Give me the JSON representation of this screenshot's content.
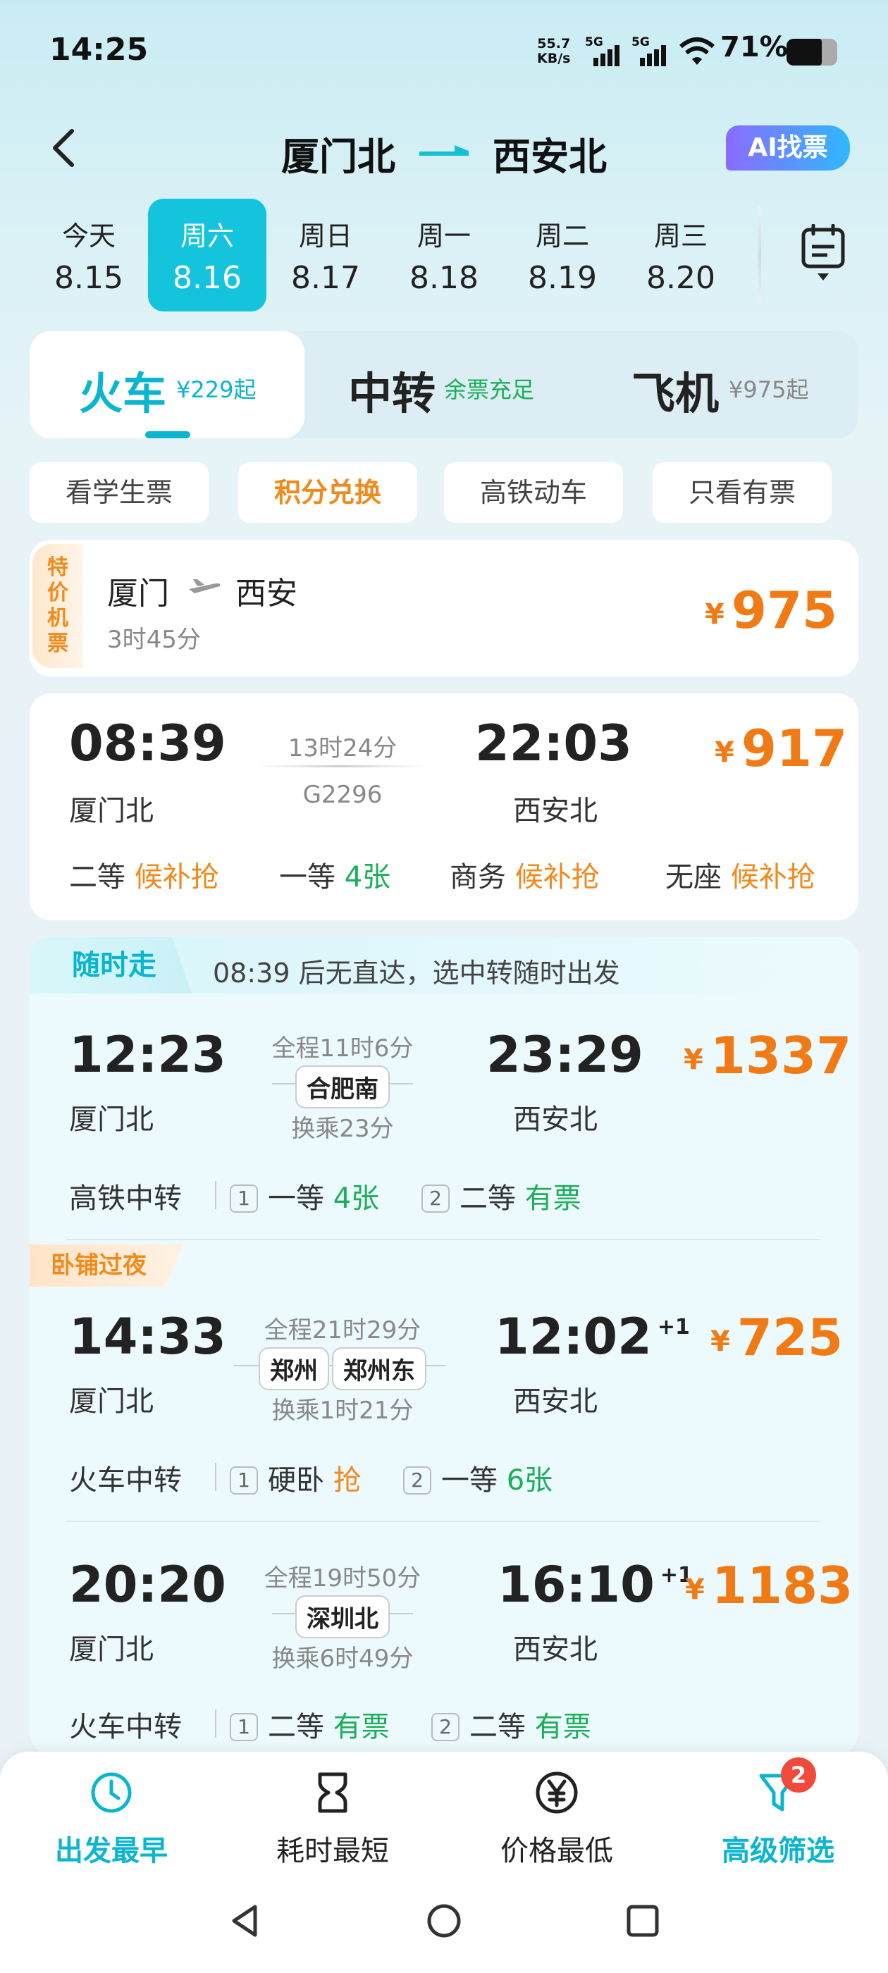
{
  "status": {
    "time": "14:25",
    "net_speed": "55.7",
    "net_unit": "KB/s",
    "sig1": "5G",
    "sig2": "5G",
    "battery": "71%"
  },
  "header": {
    "from": "厦门北",
    "to": "西安北",
    "ai_button": "AI找票"
  },
  "dates": [
    {
      "week": "今天",
      "date": "8.15"
    },
    {
      "week": "周六",
      "date": "8.16",
      "selected": true
    },
    {
      "week": "周日",
      "date": "8.17"
    },
    {
      "week": "周一",
      "date": "8.18"
    },
    {
      "week": "周二",
      "date": "8.19"
    },
    {
      "week": "周三",
      "date": "8.20"
    }
  ],
  "modes": {
    "train": {
      "label": "火车",
      "sub": "¥229起"
    },
    "transfer": {
      "label": "中转",
      "sub": "余票充足"
    },
    "flight": {
      "label": "飞机",
      "sub": "¥975起"
    }
  },
  "filters": [
    "看学生票",
    "积分兑换",
    "高铁动车",
    "只看有票"
  ],
  "cheap_flight": {
    "tag": "特价机票",
    "from": "厦门",
    "to": "西安",
    "duration": "3时45分",
    "currency": "¥",
    "price": "975"
  },
  "train": {
    "dep_time": "08:39",
    "dep_station": "厦门北",
    "duration": "13时24分",
    "number": "G2296",
    "arr_time": "22:03",
    "arr_station": "西安北",
    "currency": "¥",
    "price": "917",
    "seats": [
      {
        "cls": "二等",
        "status": "候补抢"
      },
      {
        "cls": "一等",
        "status": "4张"
      },
      {
        "cls": "商务",
        "status": "候补抢"
      },
      {
        "cls": "无座",
        "status": "候补抢"
      }
    ]
  },
  "anytime": {
    "tag": "随时走",
    "message": "08:39 后无直达，选中转随时出发"
  },
  "transfers": [
    {
      "dep_time": "12:23",
      "dep_station": "厦门北",
      "total": "全程11时6分",
      "via": [
        "合肥南"
      ],
      "wait": "换乘23分",
      "arr_time": "23:29",
      "arr_station": "西安北",
      "plus": "",
      "currency": "¥",
      "price": "1337",
      "kind": "高铁中转",
      "legs": [
        {
          "n": "1",
          "cls": "一等",
          "status": "4张"
        },
        {
          "n": "2",
          "cls": "二等",
          "status": "有票"
        }
      ]
    },
    {
      "dep_time": "14:33",
      "dep_station": "厦门北",
      "total": "全程21时29分",
      "via": [
        "郑州",
        "郑州东"
      ],
      "wait": "换乘1时21分",
      "arr_time": "12:02",
      "arr_station": "西安北",
      "plus": "+1",
      "currency": "¥",
      "price": "725",
      "kind": "火车中转",
      "legs": [
        {
          "n": "1",
          "cls": "硬卧",
          "status": "抢"
        },
        {
          "n": "2",
          "cls": "一等",
          "status": "6张"
        }
      ]
    },
    {
      "dep_time": "20:20",
      "dep_station": "厦门北",
      "total": "全程19时50分",
      "via": [
        "深圳北"
      ],
      "wait": "换乘6时49分",
      "arr_time": "16:10",
      "arr_station": "西安北",
      "plus": "+1",
      "currency": "¥",
      "price": "1183",
      "kind": "火车中转",
      "legs": [
        {
          "n": "1",
          "cls": "二等",
          "status": "有票"
        },
        {
          "n": "2",
          "cls": "二等",
          "status": "有票"
        }
      ]
    }
  ],
  "sleeper_tag": "卧铺过夜",
  "bottom_tabs": [
    {
      "label": "出发最早",
      "icon": "clock-icon",
      "active": true
    },
    {
      "label": "耗时最短",
      "icon": "hourglass-icon"
    },
    {
      "label": "价格最低",
      "icon": "yen-icon"
    },
    {
      "label": "高级筛选",
      "icon": "filter-icon",
      "active": true,
      "badge": "2"
    }
  ],
  "colors": {
    "accent": "#14c3dc",
    "price": "#f07b16",
    "available": "#1cae5a",
    "waitlist": "#f08a1c"
  }
}
